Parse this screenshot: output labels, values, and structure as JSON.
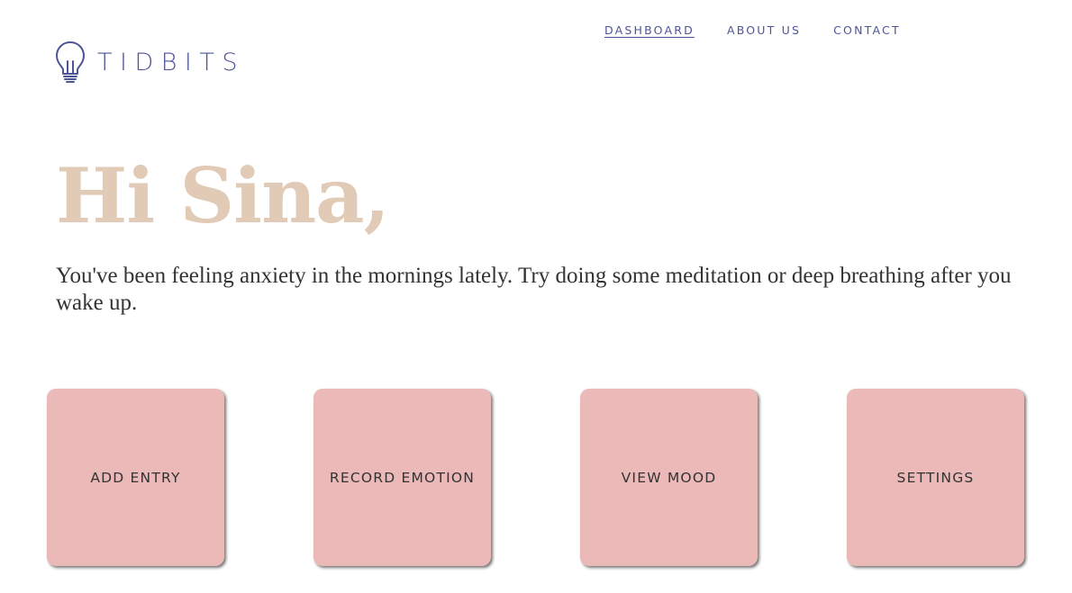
{
  "brand": {
    "name": "TIDBITS",
    "icon": "lightbulb-icon",
    "color": "#4e5597"
  },
  "nav": {
    "items": [
      {
        "label": "DASHBOARD",
        "active": true
      },
      {
        "label": "ABOUT US",
        "active": false
      },
      {
        "label": "CONTACT",
        "active": false
      }
    ]
  },
  "hero": {
    "greeting": "Hi Sina,",
    "greeting_color": "#e1cbb6",
    "message": "You've been feeling anxiety in the mornings lately. Try doing some meditation or deep breathing after you wake up."
  },
  "tiles": [
    {
      "label": "ADD ENTRY"
    },
    {
      "label": "RECORD EMOTION"
    },
    {
      "label": "VIEW MOOD"
    },
    {
      "label": "SETTINGS"
    }
  ],
  "colors": {
    "tile_background": "#ebb9b7",
    "text": "#333333"
  }
}
